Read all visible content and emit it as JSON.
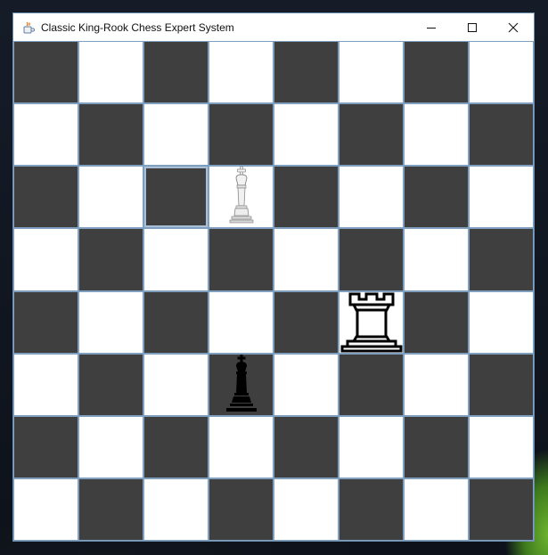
{
  "window": {
    "title": "Classic King-Rook Chess Expert System",
    "app_icon": "java-cup-icon",
    "controls": [
      "minimize-icon",
      "maximize-icon",
      "close-icon"
    ]
  },
  "board": {
    "size": 8,
    "colors": {
      "dark": "#3f3f3f",
      "light": "#ffffff",
      "border": "#7f9fc0"
    },
    "selected_square": {
      "row": 2,
      "col": 2
    },
    "pieces": [
      {
        "row": 2,
        "col": 3,
        "type": "king",
        "color": "white",
        "icon": "white-king-icon"
      },
      {
        "row": 4,
        "col": 5,
        "type": "rook",
        "color": "white",
        "icon": "white-rook-icon"
      },
      {
        "row": 5,
        "col": 3,
        "type": "king",
        "color": "black",
        "icon": "black-king-icon"
      }
    ]
  }
}
